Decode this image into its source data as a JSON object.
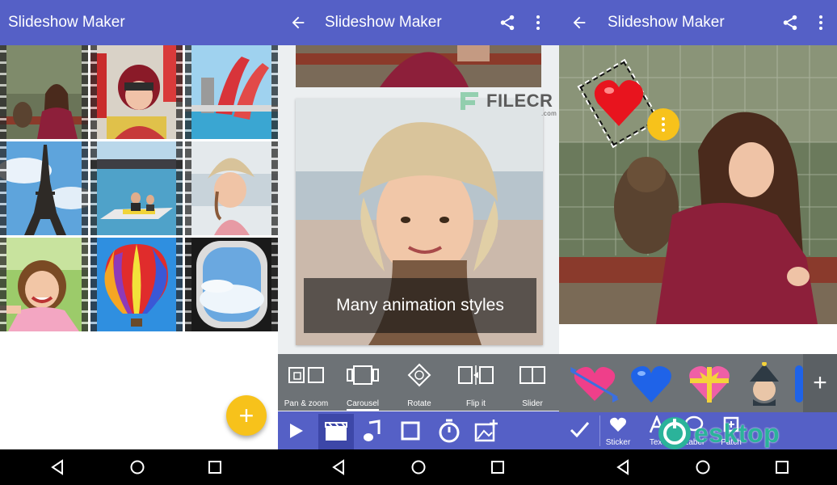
{
  "panels": [
    {
      "title": "Slideshow Maker"
    },
    {
      "title": "Slideshow Maker"
    },
    {
      "title": "Slideshow Maker"
    }
  ],
  "fab_label": "+",
  "caption": "Many animation styles",
  "watermark": {
    "brand": "FILECR",
    "tld": ".com"
  },
  "animations": [
    {
      "label": "Pan & zoom"
    },
    {
      "label": "Carousel"
    },
    {
      "label": "Rotate"
    },
    {
      "label": "Flip it"
    },
    {
      "label": "Slider"
    }
  ],
  "sticker_add_label": "+",
  "tools": [
    {
      "label": "Sticker"
    },
    {
      "label": "Text"
    },
    {
      "label": "Label"
    },
    {
      "label": "Patch"
    }
  ],
  "desktop_watermark": "esktop",
  "colors": {
    "appbar": "#5560c6",
    "fab": "#f7c21b",
    "strip": "#6d7276"
  }
}
